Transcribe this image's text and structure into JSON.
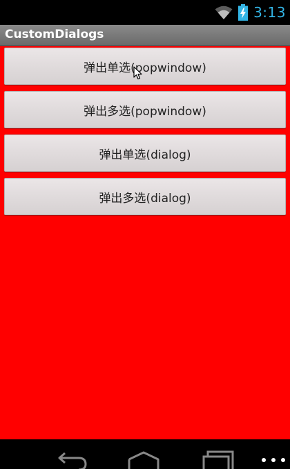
{
  "status_bar": {
    "time": "3:13",
    "icons": [
      "wifi-icon",
      "battery-charging-icon"
    ],
    "accent_color": "#33b5e5"
  },
  "app": {
    "title": "CustomDialogs",
    "background_color": "#ff0000"
  },
  "buttons": [
    {
      "label": "弹出单选(popwindow)"
    },
    {
      "label": "弹出多选(popwindow)"
    },
    {
      "label": "弹出单选(dialog)"
    },
    {
      "label": "弹出多选(dialog)"
    }
  ],
  "nav_bar": {
    "icons": [
      "back-icon",
      "home-icon",
      "recent-apps-icon",
      "overflow-menu-icon"
    ]
  }
}
